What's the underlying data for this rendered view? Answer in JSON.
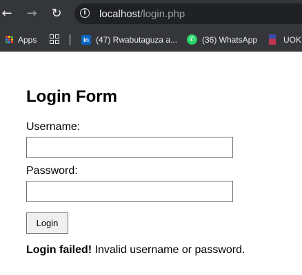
{
  "browser": {
    "url_host": "localhost",
    "url_path": "/login.php",
    "nav_icons": {
      "back": "arrow-left-icon",
      "forward": "arrow-right-icon",
      "reload": "reload-icon",
      "site_info": "info-icon"
    },
    "bookmarks": {
      "apps_label": "Apps",
      "linkedin_label": "(47) Rwabutaguza a...",
      "whatsapp_label": "(36) WhatsApp",
      "uok_label": "UOK"
    },
    "colors": {
      "toolbar": "#35363a",
      "omnibox": "#202124",
      "linkedin": "#0a66c2",
      "whatsapp": "#25d366"
    }
  },
  "form": {
    "title": "Login Form",
    "username_label": "Username:",
    "username_value": "",
    "password_label": "Password:",
    "password_value": "",
    "login_button_label": "Login"
  },
  "message": {
    "bold_text": "Login failed!",
    "text": " Invalid username or password."
  }
}
